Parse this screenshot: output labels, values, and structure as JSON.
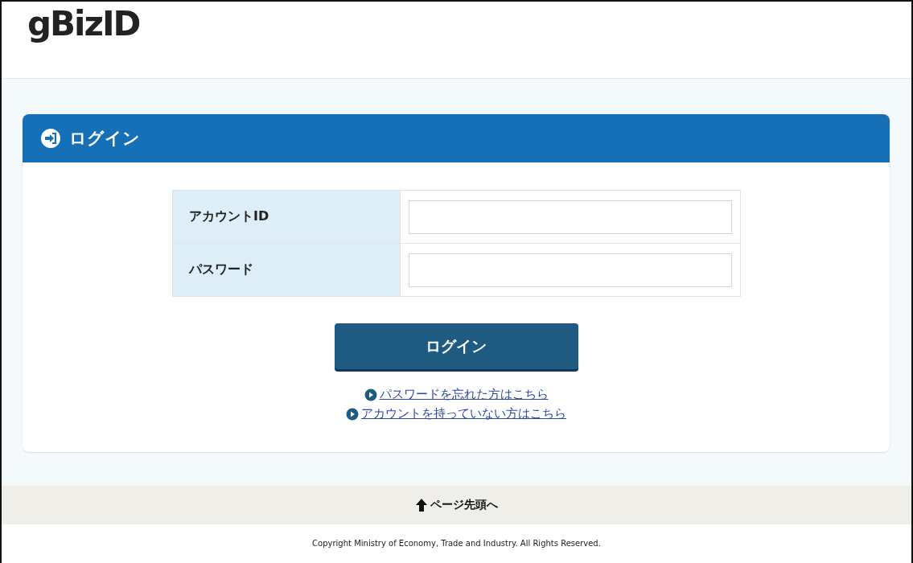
{
  "header": {
    "logo": "gBizID"
  },
  "panel": {
    "title": "ログイン"
  },
  "form": {
    "fields": [
      {
        "label": "アカウントID"
      },
      {
        "label": "パスワード"
      }
    ],
    "submit": "ログイン",
    "links": [
      "パスワードを忘れた方はこちら",
      "アカウントを持っていない方はこちら"
    ]
  },
  "footer": {
    "page_top": "ページ先頭へ",
    "copyright": "Copyright Ministry of Economy, Trade and Industry. All Rights Reserved."
  }
}
